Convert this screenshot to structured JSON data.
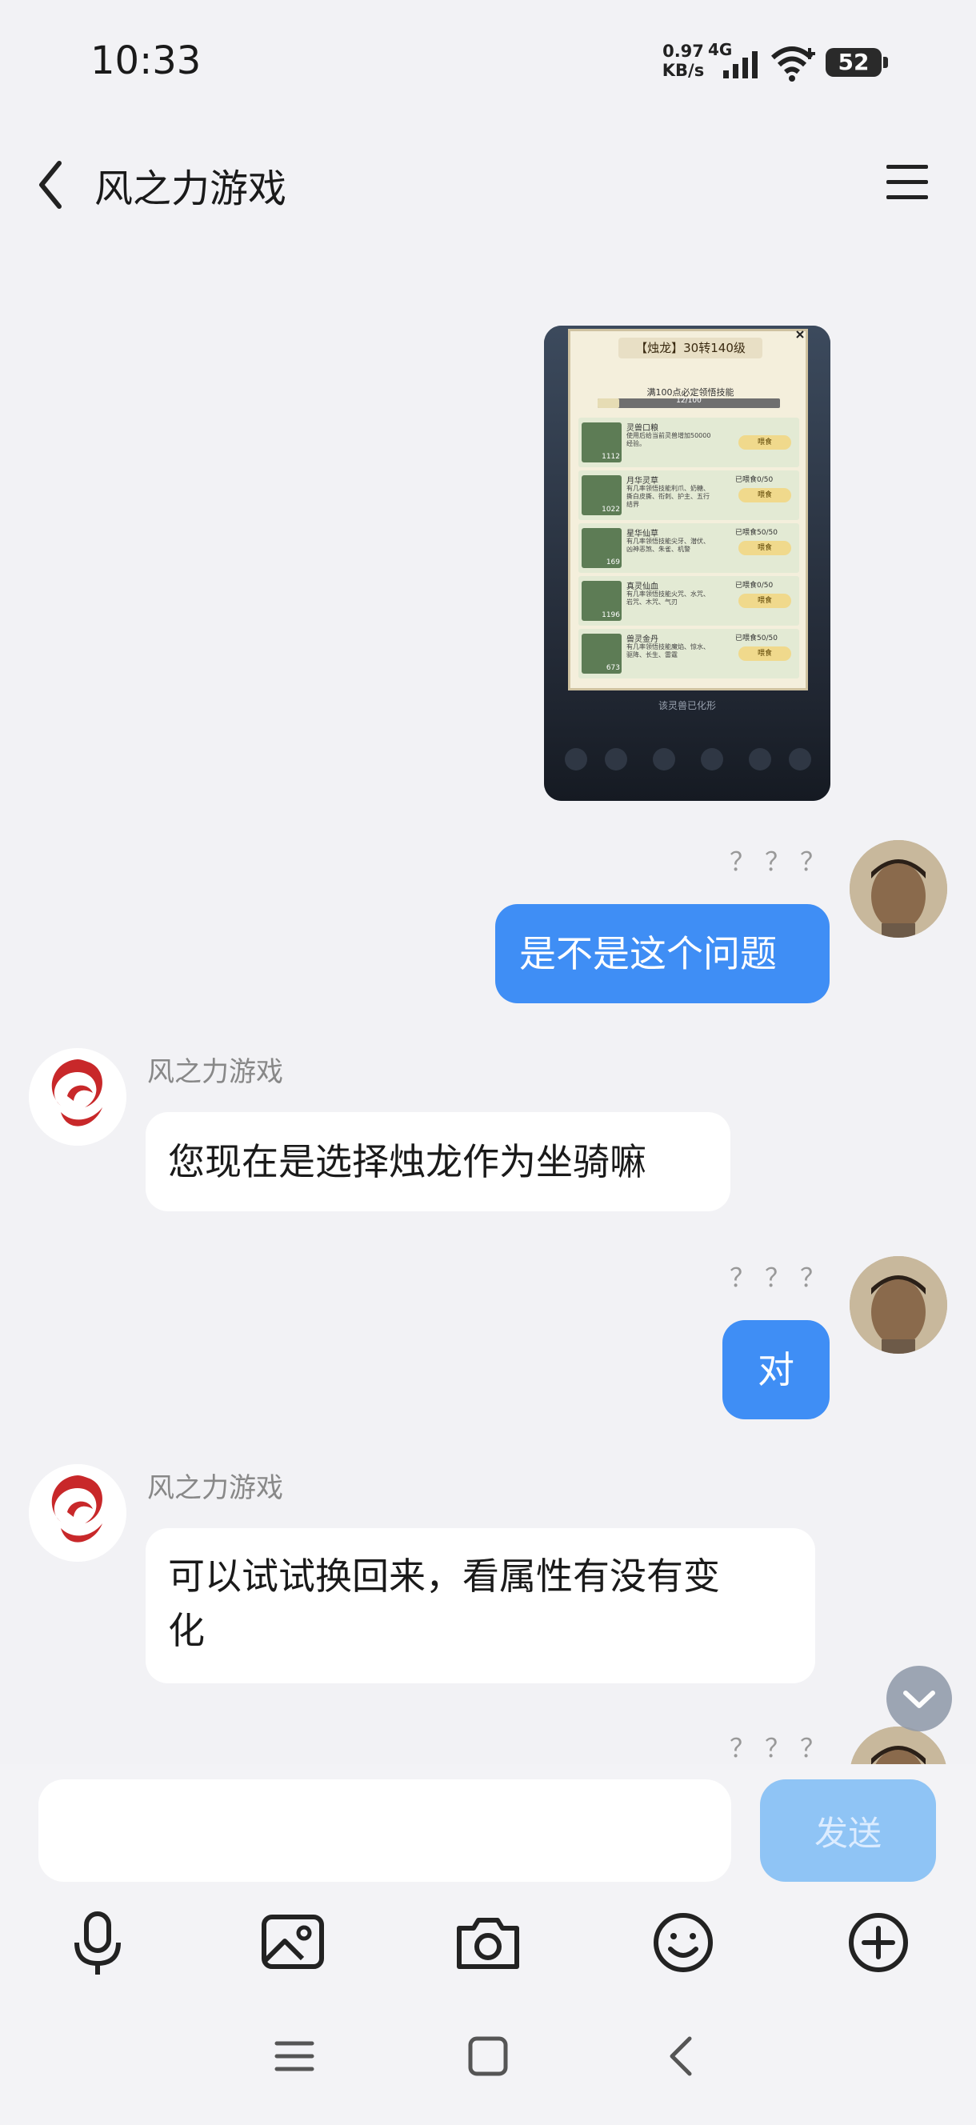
{
  "status_bar": {
    "time": "10:33",
    "net_speed_value": "0.97",
    "net_speed_unit": "KB/s",
    "network": "4G",
    "battery": "52"
  },
  "header": {
    "title": "风之力游戏"
  },
  "messages": [
    {
      "side": "out",
      "type": "image",
      "read_marks": "？？？"
    },
    {
      "side": "out",
      "type": "text",
      "text": "是不是这个问题"
    },
    {
      "side": "in",
      "sender": "风之力游戏",
      "text": "您现在是选择烛龙作为坐骑嘛"
    },
    {
      "side": "out",
      "type": "text",
      "read_marks": "？？？",
      "text": "对"
    },
    {
      "side": "in",
      "sender": "风之力游戏",
      "text_line1": "可以试试换回来，看属性有没有变",
      "text_line2": "化"
    },
    {
      "side": "out",
      "type": "partial",
      "read_marks": "？？？"
    }
  ],
  "shared_image": {
    "panel_title": "【烛龙】30转140级",
    "subtitle": "满100点必定领悟技能",
    "progress_text": "12/100",
    "progress_fraction": 0.12,
    "footer": "该灵兽已化形",
    "items": [
      {
        "name": "灵兽口粮",
        "count": "1112",
        "status": "",
        "desc": "使用后给当前灵兽增加50000经验。",
        "button": "喂食"
      },
      {
        "name": "月华灵草",
        "count": "1022",
        "status": "已喂食0/50",
        "desc": "有几率领悟技能利爪、奶糖、撕白皮撕、衔刺、护主、五行结界",
        "button": "喂食"
      },
      {
        "name": "星华仙草",
        "count": "169",
        "status": "已喂食50/50",
        "desc": "有几率领悟技能尖牙、潜伏、凶神恶煞、朱雀、机警",
        "button": "喂食"
      },
      {
        "name": "真灵仙血",
        "count": "1196",
        "status": "已喂食0/50",
        "desc": "有几率领悟技能火咒、水咒、岩咒、木咒、气刃",
        "button": "喂食"
      },
      {
        "name": "兽灵金丹",
        "count": "673",
        "status": "已喂食50/50",
        "desc": "有几率领悟技能魔焰、惊水、驱降、长生、雷霆",
        "button": "喂食"
      }
    ]
  },
  "input": {
    "placeholder": "",
    "send_label": "发送"
  },
  "colors": {
    "bubble_out": "#3f8ef5",
    "send_disabled": "#8fc4f5",
    "background": "#f2f2f5"
  }
}
